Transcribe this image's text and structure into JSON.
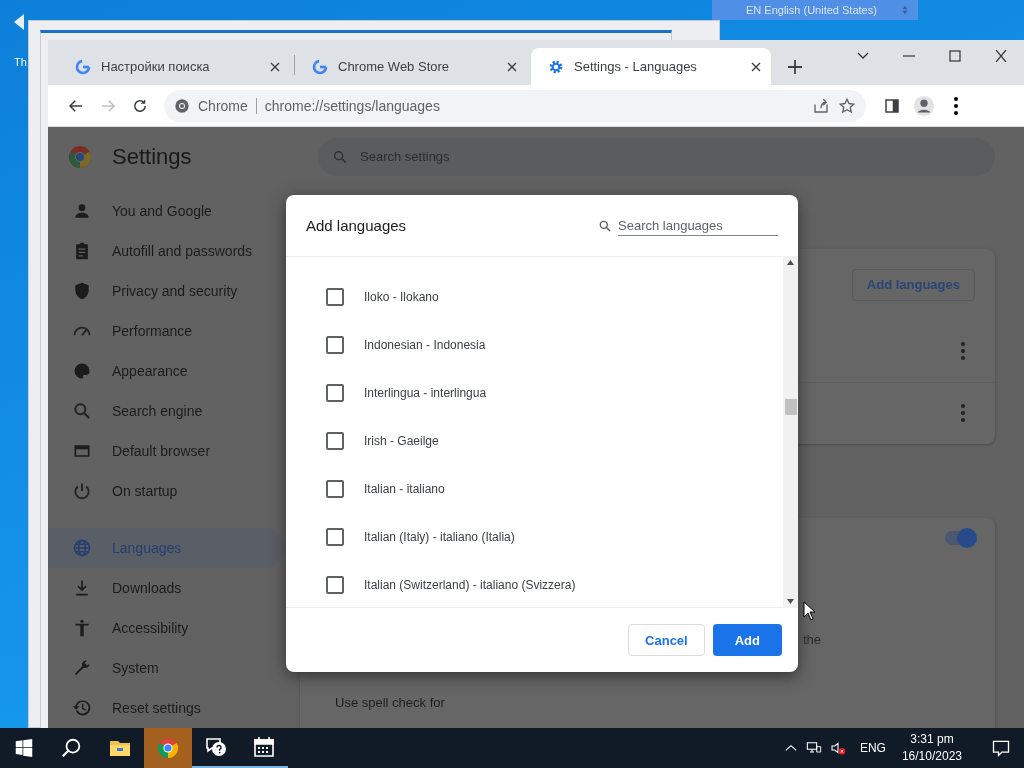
{
  "desktop": {
    "icon_label": "Th",
    "language_dropdown": "EN English (United States)"
  },
  "browser": {
    "tabs": [
      {
        "title": "Настройки поиска",
        "kind": "google",
        "selected": false
      },
      {
        "title": "Chrome Web Store",
        "kind": "google",
        "selected": false
      },
      {
        "title": "Settings - Languages",
        "kind": "settings",
        "selected": true
      }
    ],
    "address": {
      "site": "Chrome",
      "url": "chrome://settings/languages"
    }
  },
  "settings": {
    "title": "Settings",
    "search_placeholder": "Search settings",
    "sidebar": [
      {
        "label": "You and Google",
        "selected": false
      },
      {
        "label": "Autofill and passwords",
        "selected": false
      },
      {
        "label": "Privacy and security",
        "selected": false
      },
      {
        "label": "Performance",
        "selected": false
      },
      {
        "label": "Appearance",
        "selected": false
      },
      {
        "label": "Search engine",
        "selected": false
      },
      {
        "label": "Default browser",
        "selected": false
      },
      {
        "label": "On startup",
        "selected": false
      },
      {
        "label": "Languages",
        "selected": true
      },
      {
        "label": "Downloads",
        "selected": false
      },
      {
        "label": "Accessibility",
        "selected": false
      },
      {
        "label": "System",
        "selected": false
      },
      {
        "label": "Reset settings",
        "selected": false
      }
    ],
    "languages_card": {
      "button": "Add languages"
    },
    "spell_check": {
      "on": true,
      "fragment": "the",
      "label": "Use spell check for"
    }
  },
  "dialog": {
    "title": "Add languages",
    "search_placeholder": "Search languages",
    "languages": [
      {
        "label": "Iloko - Ilokano",
        "checked": false
      },
      {
        "label": "Indonesian - Indonesia",
        "checked": false
      },
      {
        "label": "Interlingua - interlingua",
        "checked": false
      },
      {
        "label": "Irish - Gaeilge",
        "checked": false
      },
      {
        "label": "Italian - italiano",
        "checked": false
      },
      {
        "label": "Italian (Italy) - italiano (Italia)",
        "checked": false
      },
      {
        "label": "Italian (Switzerland) - italiano (Svizzera)",
        "checked": false
      }
    ],
    "buttons": [
      {
        "label": "Cancel",
        "kind": "secondary"
      },
      {
        "label": "Add",
        "kind": "primary"
      }
    ]
  },
  "taskbar": {
    "apps": [
      {
        "kind": "explorer",
        "open": false,
        "attention": false
      },
      {
        "kind": "chrome",
        "open": false,
        "attention": true
      },
      {
        "kind": "help",
        "open": true,
        "attention": false
      },
      {
        "kind": "calendar",
        "open": true,
        "attention": false
      }
    ],
    "language": "ENG",
    "time": "3:31 pm",
    "date": "16/10/2023"
  }
}
